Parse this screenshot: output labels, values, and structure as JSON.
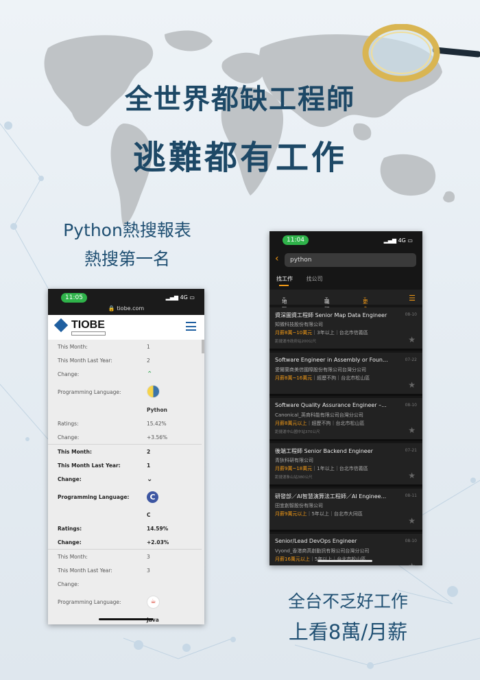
{
  "poster": {
    "title_line1": "全世界都缺工程師",
    "title_line2": "逃難都有工作",
    "left_caption_1": "Python熱搜報表",
    "left_caption_2": "熱搜第一名",
    "right_caption_1": "全台不乏好工作",
    "right_caption_2": "上看8萬/月薪"
  },
  "tiobe_phone": {
    "time": "11:05",
    "signal": "4G",
    "url": "tiobe.com",
    "logo": "TIOBE",
    "logo_tag": "the software quality company",
    "blocks": [
      {
        "bold": false,
        "this_month_label": "This Month:",
        "this_month": "1",
        "last_year_label": "This Month Last Year:",
        "last_year": "2",
        "change_label": "Change:",
        "change": "up",
        "lang_label": "Programming Language:",
        "lang_icon": "python-logo-icon",
        "lang": "Python",
        "ratings_label": "Ratings:",
        "ratings": "15.42%",
        "change2_label": "Change:",
        "change2": "+3.56%"
      },
      {
        "bold": true,
        "this_month_label": "This Month:",
        "this_month": "2",
        "last_year_label": "This Month Last Year:",
        "last_year": "1",
        "change_label": "Change:",
        "change": "down",
        "lang_label": "Programming Language:",
        "lang_icon": "c-logo-icon",
        "lang": "C",
        "ratings_label": "Ratings:",
        "ratings": "14.59%",
        "change2_label": "Change:",
        "change2": "+2.03%"
      },
      {
        "bold": false,
        "this_month_label": "This Month:",
        "this_month": "3",
        "last_year_label": "This Month Last Year:",
        "last_year": "3",
        "change_label": "Change:",
        "change": "",
        "lang_label": "Programming Language:",
        "lang_icon": "java-logo-icon",
        "lang": "Java"
      }
    ]
  },
  "jobs_phone": {
    "time": "11:04",
    "signal": "4G",
    "search_value": "python",
    "tabs": [
      "找工作",
      "找公司"
    ],
    "filters": {
      "area": "地區",
      "category": "職類",
      "more": "更多(2)"
    },
    "jobs": [
      {
        "title": "資深圖資工程師 Senior Map Data Engineer",
        "date": "08-10",
        "company": "知微科技股份有限公司",
        "salary": "月薪8萬~10萬元",
        "meta": "3年以上｜台北市信義區",
        "note": "距捷運市政府站200公尺"
      },
      {
        "title": "Software Engineer in Assembly or Foun...",
        "date": "07-22",
        "company": "愛爾蘭商美信國際股份有限公司台灣分公司",
        "salary": "月薪8萬~16萬元",
        "meta": "經歷不拘｜台北市松山區",
        "note": ""
      },
      {
        "title": "Software Quality Assurance Engineer –...",
        "date": "08-10",
        "company": "Canonical_英商科能有限公司台灣分公司",
        "salary": "月薪8萬元以上",
        "meta": "經歷不拘｜台北市松山區",
        "note": "距捷運中山國中站370公尺"
      },
      {
        "title": "後端工程師 Senior Backend Engineer",
        "date": "07-21",
        "company": "青狄科研有限公司",
        "salary": "月薪9萬~18萬元",
        "meta": "1年以上｜台北市信義區",
        "note": "距捷運象山站380公尺"
      },
      {
        "title": "研發部／AI智慧演算法工程師／AI Enginee...",
        "date": "08-11",
        "company": "田宜創智股份有限公司",
        "salary": "月薪9萬元以上",
        "meta": "5年以上｜台北市大同區",
        "note": ""
      },
      {
        "title": "Senior/Lead DevOps Engineer",
        "date": "08-10",
        "company": "Vyond_香港商高創動訊有限公司台灣分公司",
        "salary": "月薪16萬元以上",
        "meta": "5年以上｜台北市松山區",
        "note": ""
      }
    ]
  }
}
